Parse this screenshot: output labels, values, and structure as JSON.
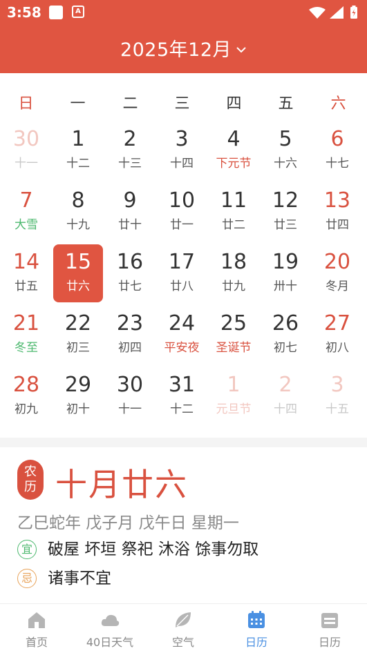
{
  "status_bar": {
    "time": "3:58",
    "notif_glyph": "A"
  },
  "header": {
    "month_title": "2025年12月"
  },
  "weekdays": [
    "日",
    "一",
    "二",
    "三",
    "四",
    "五",
    "六"
  ],
  "calendar": {
    "rows": [
      [
        {
          "day": "30",
          "lunar": "十一",
          "other": true
        },
        {
          "day": "1",
          "lunar": "十二"
        },
        {
          "day": "2",
          "lunar": "十三"
        },
        {
          "day": "3",
          "lunar": "十四"
        },
        {
          "day": "4",
          "lunar": "下元节",
          "type": "festival"
        },
        {
          "day": "5",
          "lunar": "十六"
        },
        {
          "day": "6",
          "lunar": "十七"
        }
      ],
      [
        {
          "day": "7",
          "lunar": "大雪",
          "type": "term"
        },
        {
          "day": "8",
          "lunar": "十九"
        },
        {
          "day": "9",
          "lunar": "廿十"
        },
        {
          "day": "10",
          "lunar": "廿一"
        },
        {
          "day": "11",
          "lunar": "廿二"
        },
        {
          "day": "12",
          "lunar": "廿三"
        },
        {
          "day": "13",
          "lunar": "廿四"
        }
      ],
      [
        {
          "day": "14",
          "lunar": "廿五"
        },
        {
          "day": "15",
          "lunar": "廿六",
          "selected": true
        },
        {
          "day": "16",
          "lunar": "廿七"
        },
        {
          "day": "17",
          "lunar": "廿八"
        },
        {
          "day": "18",
          "lunar": "廿九"
        },
        {
          "day": "19",
          "lunar": "卅十"
        },
        {
          "day": "20",
          "lunar": "冬月"
        }
      ],
      [
        {
          "day": "21",
          "lunar": "冬至",
          "type": "term"
        },
        {
          "day": "22",
          "lunar": "初三"
        },
        {
          "day": "23",
          "lunar": "初四"
        },
        {
          "day": "24",
          "lunar": "平安夜",
          "type": "festival"
        },
        {
          "day": "25",
          "lunar": "圣诞节",
          "type": "festival"
        },
        {
          "day": "26",
          "lunar": "初七"
        },
        {
          "day": "27",
          "lunar": "初八"
        }
      ],
      [
        {
          "day": "28",
          "lunar": "初九"
        },
        {
          "day": "29",
          "lunar": "初十"
        },
        {
          "day": "30",
          "lunar": "十一"
        },
        {
          "day": "31",
          "lunar": "十二"
        },
        {
          "day": "1",
          "lunar": "元旦节",
          "type": "festival",
          "other": true
        },
        {
          "day": "2",
          "lunar": "十四",
          "other": true
        },
        {
          "day": "3",
          "lunar": "十五",
          "other": true
        }
      ]
    ]
  },
  "lunar_info": {
    "badge_top": "农",
    "badge_bottom": "历",
    "lunar_date": "十月廿六",
    "ganzhi": "乙巳蛇年 戊子月 戊午日 星期一",
    "yi_label": "宜",
    "yi_text": "破屋 坏垣 祭祀 沐浴 馀事勿取",
    "ji_label": "忌",
    "ji_text": "诸事不宜"
  },
  "nav": [
    {
      "label": "首页",
      "icon": "home-icon"
    },
    {
      "label": "40日天气",
      "icon": "cloud-icon"
    },
    {
      "label": "空气",
      "icon": "leaf-icon"
    },
    {
      "label": "日历",
      "icon": "calendar-icon",
      "active": true
    },
    {
      "label": "日历",
      "icon": "almanac-icon"
    }
  ],
  "colors": {
    "primary_red": "#E05541",
    "weekend_red": "#D9513F",
    "term_green": "#4CB86E",
    "active_blue": "#4A90E2",
    "ji_orange": "#E8A258"
  }
}
